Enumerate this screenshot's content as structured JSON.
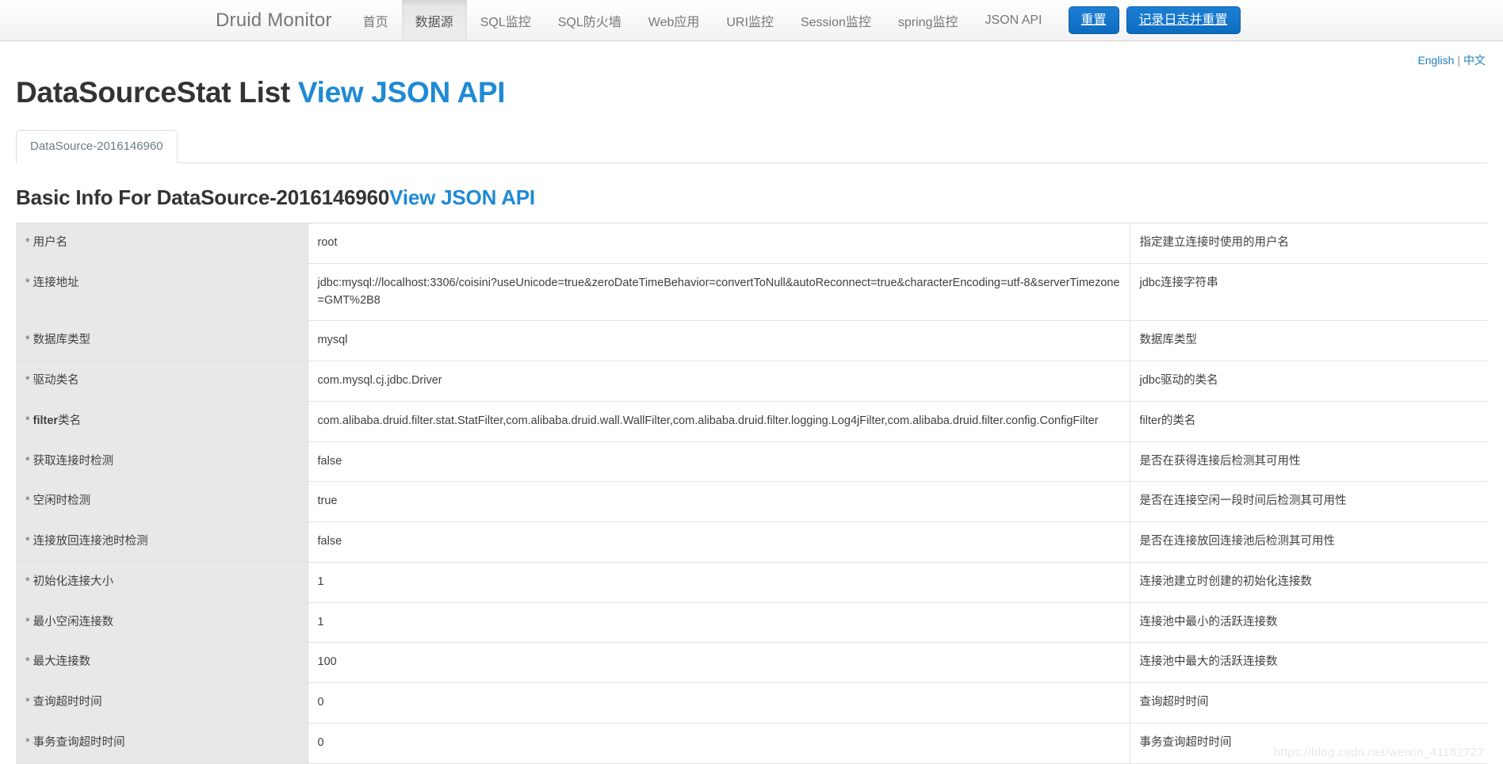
{
  "navbar": {
    "brand": "Druid Monitor",
    "items": [
      {
        "label": "首页",
        "active": false
      },
      {
        "label": "数据源",
        "active": true
      },
      {
        "label": "SQL监控",
        "active": false
      },
      {
        "label": "SQL防火墙",
        "active": false
      },
      {
        "label": "Web应用",
        "active": false
      },
      {
        "label": "URI监控",
        "active": false
      },
      {
        "label": "Session监控",
        "active": false
      },
      {
        "label": "spring监控",
        "active": false
      },
      {
        "label": "JSON API",
        "active": false
      }
    ],
    "buttons": [
      {
        "label": "重置"
      },
      {
        "label": "记录日志并重置"
      }
    ],
    "accent_color": "#0d6cc0"
  },
  "lang": {
    "english": "English",
    "separator": "|",
    "chinese": "中文",
    "link_color": "#1f7fc4"
  },
  "page": {
    "title": "DataSourceStat List",
    "title_api_link": "View JSON API",
    "section_title": "Basic Info For DataSource-2016146960",
    "section_api_link": "View JSON API",
    "watermark": "https://blog.csdn.net/weixin_41182727"
  },
  "tabs": [
    {
      "label": "DataSource-2016146960",
      "active": true
    }
  ],
  "table": {
    "rows": [
      {
        "label": "用户名",
        "value": "root",
        "desc": "指定建立连接时使用的用户名"
      },
      {
        "label": "连接地址",
        "value": "jdbc:mysql://localhost:3306/coisini?useUnicode=true&zeroDateTimeBehavior=convertToNull&autoReconnect=true&characterEncoding=utf-8&serverTimezone=GMT%2B8",
        "desc": "jdbc连接字符串"
      },
      {
        "label": "数据库类型",
        "value": "mysql",
        "desc": "数据库类型"
      },
      {
        "label": "驱动类名",
        "value": "com.mysql.cj.jdbc.Driver",
        "desc": "jdbc驱动的类名"
      },
      {
        "label": "filter类名",
        "value": "com.alibaba.druid.filter.stat.StatFilter,com.alibaba.druid.wall.WallFilter,com.alibaba.druid.filter.logging.Log4jFilter,com.alibaba.druid.filter.config.ConfigFilter",
        "desc": "filter的类名"
      },
      {
        "label": "获取连接时检测",
        "value": "false",
        "desc": "是否在获得连接后检测其可用性"
      },
      {
        "label": "空闲时检测",
        "value": "true",
        "desc": "是否在连接空闲一段时间后检测其可用性"
      },
      {
        "label": "连接放回连接池时检测",
        "value": "false",
        "desc": "是否在连接放回连接池后检测其可用性"
      },
      {
        "label": "初始化连接大小",
        "value": "1",
        "desc": "连接池建立时创建的初始化连接数"
      },
      {
        "label": "最小空闲连接数",
        "value": "1",
        "desc": "连接池中最小的活跃连接数"
      },
      {
        "label": "最大连接数",
        "value": "100",
        "desc": "连接池中最大的活跃连接数"
      },
      {
        "label": "查询超时时间",
        "value": "0",
        "desc": "查询超时时间"
      },
      {
        "label": "事务查询超时时间",
        "value": "0",
        "desc": "事务查询超时时间"
      }
    ],
    "required_marker": "*"
  }
}
